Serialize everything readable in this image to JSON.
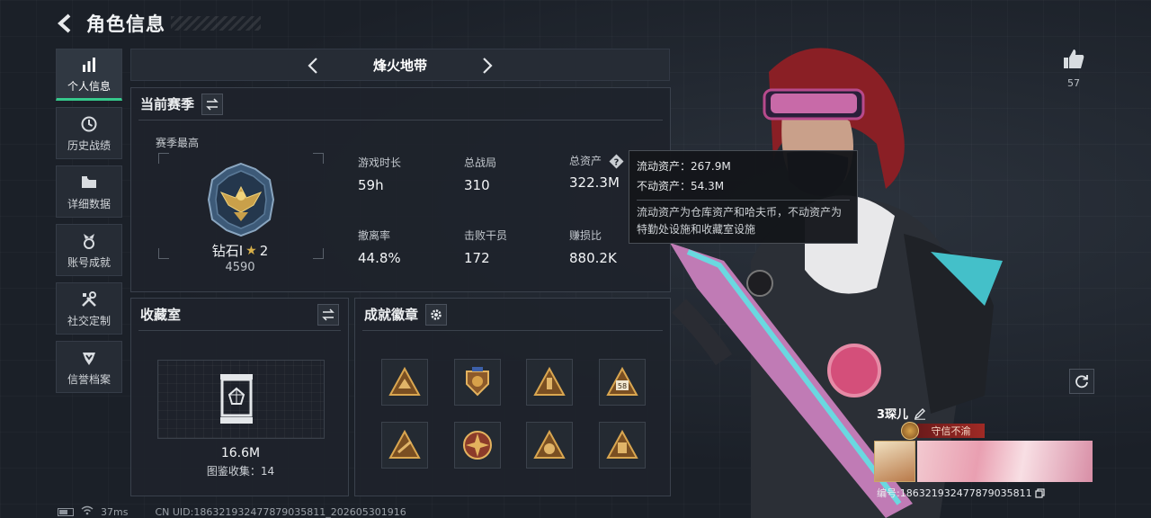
{
  "header": {
    "title": "角色信息"
  },
  "nav": {
    "items": [
      {
        "label": "个人信息",
        "icon": "bar-chart-icon",
        "active": true
      },
      {
        "label": "历史战绩",
        "icon": "clock-icon",
        "active": false
      },
      {
        "label": "详细数据",
        "icon": "folder-icon",
        "active": false
      },
      {
        "label": "账号成就",
        "icon": "medal-icon",
        "active": false
      },
      {
        "label": "社交定制",
        "icon": "tools-icon",
        "active": false
      },
      {
        "label": "信誉档案",
        "icon": "shield-icon",
        "active": false
      }
    ]
  },
  "map": {
    "name": "烽火地带"
  },
  "season": {
    "title": "当前赛季",
    "best_label": "赛季最高",
    "rank_name": "钻石I",
    "rank_star": "★",
    "rank_level": "2",
    "rank_score": "4590",
    "stats": [
      {
        "label": "游戏时长",
        "value": "59h"
      },
      {
        "label": "总战局",
        "value": "310"
      },
      {
        "label": "总资产",
        "value": "322.3M"
      },
      {
        "label": "撤离率",
        "value": "44.8%"
      },
      {
        "label": "击败干员",
        "value": "172"
      },
      {
        "label": "赚损比",
        "value": "880.2K"
      }
    ]
  },
  "tooltip": {
    "line1": "流动资产：267.9M",
    "line2": "不动资产：54.3M",
    "desc": "流动资产为仓库资产和哈夫币，不动资产为特勤处设施和收藏室设施"
  },
  "collection": {
    "title": "收藏室",
    "value": "16.6M",
    "count": "图鉴收集：14"
  },
  "achievements": {
    "title": "成就徽章",
    "badges": [
      {
        "icon": "triangle-badge-icon"
      },
      {
        "icon": "shield-badge-icon"
      },
      {
        "icon": "triangle-badge-icon"
      },
      {
        "icon": "triangle-58-badge-icon",
        "text": "58"
      },
      {
        "icon": "triangle-badge-icon"
      },
      {
        "icon": "cross-medal-icon"
      },
      {
        "icon": "triangle-badge-icon"
      },
      {
        "icon": "triangle-badge-icon"
      }
    ]
  },
  "profile": {
    "likes": "57",
    "player_name": "3琛儿",
    "honor": "守信不渝",
    "uid": "编号:1863219324778790358​11"
  },
  "status": {
    "ping": "37ms",
    "uid": "CN UID:186321932477879035811_202605301916"
  },
  "colors": {
    "accent": "#36c98c",
    "background": "#1b2028",
    "gold": "#c9a04a"
  }
}
